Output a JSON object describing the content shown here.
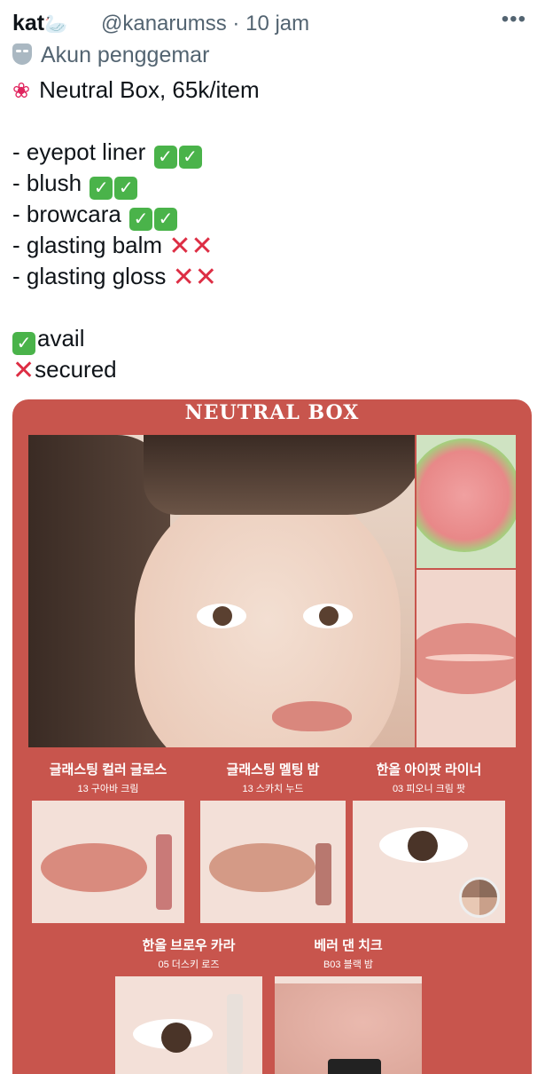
{
  "tweet": {
    "display_name": "kat",
    "name_emoji": "🦢",
    "handle": "@kanarumss",
    "separator": "·",
    "time": "10 jam",
    "more_label": "•••",
    "fan_label": "Akun penggemar",
    "lines": {
      "title": "Neutral Box, 65k/item",
      "item1": "- eyepot liner",
      "item2": "- blush",
      "item3": "- browcara",
      "item4": "- glasting balm",
      "item5": "- glasting gloss",
      "legend_avail": "avail",
      "legend_secured": "secured"
    },
    "check_glyph": "✓",
    "cross_glyph": "✕✕",
    "cross_single": "✕"
  },
  "media": {
    "title": "NEUTRAL BOX",
    "products": [
      {
        "name": "글래스팅 컬러 글로스",
        "shade": "13 구아바 크림"
      },
      {
        "name": "글래스팅 멜팅 밤",
        "shade": "13 스카치 누드"
      },
      {
        "name": "한올 아이팟 라이너",
        "shade": "03 피오니 크림 팟"
      },
      {
        "name": "한올 브로우 카라",
        "shade": "05 더스키 로즈"
      },
      {
        "name": "베러 댄 치크",
        "shade": "B03 블랙 밤"
      }
    ]
  },
  "colors": {
    "check_green": "#4ab34a",
    "cross_red": "#dd2e44",
    "brand_coral": "#c8554d"
  }
}
